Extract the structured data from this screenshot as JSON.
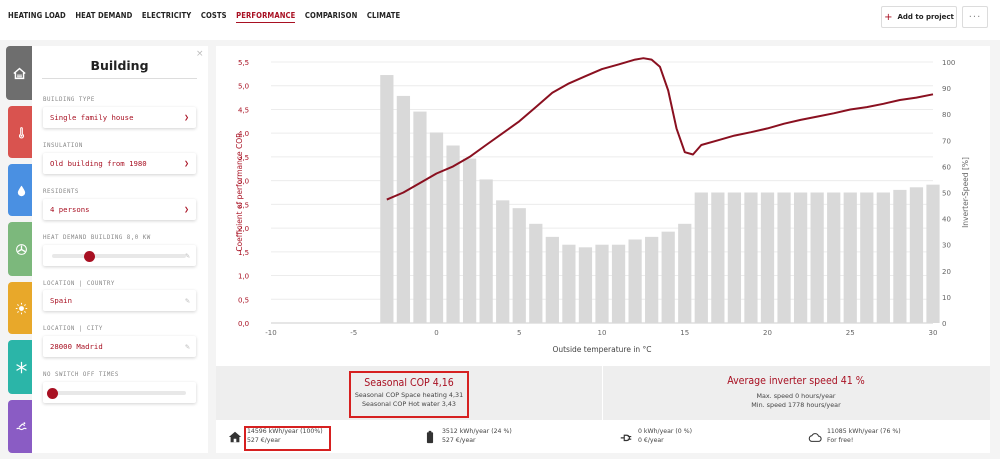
{
  "nav": {
    "tabs": [
      "HEATING LOAD",
      "HEAT DEMAND",
      "ELECTRICITY",
      "COSTS",
      "PERFORMANCE",
      "COMPARISON",
      "CLIMATE"
    ],
    "active_tab": "PERFORMANCE",
    "add_label": "Add to project",
    "more_label": "···"
  },
  "sidebar": {
    "title": "Building",
    "close": "×",
    "building_type_label": "BUILDING TYPE",
    "building_type_value": "Single family house",
    "insulation_label": "INSULATION",
    "insulation_value": "Old building from 1980",
    "residents_label": "RESIDENTS",
    "residents_value": "4 persons",
    "heat_demand_label": "HEAT DEMAND BUILDING 8,0 KW",
    "heat_demand_slider_fraction": 0.28,
    "country_label": "LOCATION | COUNTRY",
    "country_value": "Spain",
    "city_label": "LOCATION | CITY",
    "city_value": "28000 Madrid",
    "switch_off_label": "NO SWITCH OFF TIMES",
    "switch_off_slider_fraction": 0.0,
    "icons": [
      {
        "name": "house-roof-icon",
        "color": "#6e6e6e"
      },
      {
        "name": "thermometer-icon",
        "color": "#d9534f"
      },
      {
        "name": "water-drop-icon",
        "color": "#4a90e2"
      },
      {
        "name": "fan-icon",
        "color": "#7cb87c"
      },
      {
        "name": "sun-icon",
        "color": "#e8a82a"
      },
      {
        "name": "snowflake-icon",
        "color": "#2bb5a8"
      },
      {
        "name": "pool-icon",
        "color": "#8a5cc4"
      }
    ]
  },
  "chart_data": {
    "type": "bar+line",
    "xlabel": "Outside temperature in °C",
    "ylabel_left": "Coefficient of performance COP",
    "ylabel_right": "Inverter-Speed [%]",
    "xlim": [
      -10,
      30
    ],
    "ylim_left": [
      0,
      5.5
    ],
    "ylim_right": [
      0,
      100
    ],
    "x_ticks": [
      -10,
      -5,
      0,
      5,
      10,
      15,
      20,
      25,
      30
    ],
    "x_tick_labels": [
      "-10",
      "-5",
      "0",
      "5",
      "10",
      "15",
      "20",
      "25",
      "30"
    ],
    "y_left_ticks": [
      0,
      0.5,
      1.0,
      1.5,
      2.0,
      2.5,
      3.0,
      3.5,
      4.0,
      4.5,
      5.0,
      5.5
    ],
    "y_left_tick_labels": [
      "0,0",
      "0,5",
      "1,0",
      "1,5",
      "2,0",
      "2,5",
      "3,0",
      "3,5",
      "4,0",
      "4,5",
      "5,0",
      "5,5"
    ],
    "y_right_ticks": [
      0,
      10,
      20,
      30,
      40,
      50,
      60,
      70,
      80,
      90,
      100
    ],
    "y_right_tick_labels": [
      "0",
      "10",
      "20",
      "30",
      "40",
      "50",
      "60",
      "70",
      "80",
      "90",
      "100"
    ],
    "bars": {
      "series": "Inverter-Speed [%]",
      "axis": "right",
      "x": [
        -3,
        -2,
        -1,
        0,
        1,
        2,
        3,
        4,
        5,
        6,
        7,
        8,
        9,
        10,
        11,
        12,
        13,
        14,
        15,
        16,
        17,
        18,
        19,
        20,
        21,
        22,
        23,
        24,
        25,
        26,
        27,
        28,
        29,
        30
      ],
      "values": [
        95,
        87,
        81,
        73,
        68,
        63,
        55,
        47,
        44,
        38,
        33,
        30,
        29,
        30,
        30,
        32,
        33,
        35,
        38,
        50,
        50,
        50,
        50,
        50,
        50,
        50,
        50,
        50,
        50,
        50,
        50,
        51,
        52,
        53
      ]
    },
    "line": {
      "series": "COP",
      "axis": "left",
      "x": [
        -3,
        -2,
        -1,
        0,
        1,
        2,
        3,
        4,
        5,
        6,
        7,
        8,
        9,
        10,
        11,
        12,
        12.5,
        13,
        13.5,
        14,
        14.5,
        15,
        15.5,
        16,
        17,
        18,
        19,
        20,
        21,
        22,
        23,
        24,
        25,
        26,
        27,
        28,
        29,
        30
      ],
      "values": [
        2.6,
        2.75,
        2.95,
        3.15,
        3.3,
        3.5,
        3.75,
        4.0,
        4.25,
        4.55,
        4.85,
        5.05,
        5.2,
        5.35,
        5.45,
        5.55,
        5.58,
        5.55,
        5.4,
        4.9,
        4.1,
        3.6,
        3.55,
        3.75,
        3.85,
        3.95,
        4.02,
        4.1,
        4.2,
        4.28,
        4.35,
        4.42,
        4.5,
        4.55,
        4.62,
        4.7,
        4.75,
        4.82
      ]
    },
    "bar_color": "#d9d9d9",
    "line_color": "#8a1020"
  },
  "stats": {
    "seasonal_cop": "Seasonal COP 4,16",
    "seasonal_heating": "Seasonal COP Space heating 4,31",
    "seasonal_hot_water": "Seasonal COP Hot water 3,43",
    "inverter_title": "Average inverter speed 41 %",
    "inverter_max": "Max. speed 0 hours/year",
    "inverter_min": "Min. speed 1778 hours/year"
  },
  "energy": [
    {
      "icon": "house-icon",
      "line1": "14596 kWh/year (100%)",
      "line2": "527 €/year"
    },
    {
      "icon": "battery-icon",
      "line1": "3512 kWh/year (24 %)",
      "line2": "527 €/year"
    },
    {
      "icon": "plug-icon",
      "line1": "0 kWh/year (0 %)",
      "line2": "0 €/year"
    },
    {
      "icon": "cloud-icon",
      "line1": "11085 kWh/year (76 %)",
      "line2": "For free!"
    }
  ]
}
